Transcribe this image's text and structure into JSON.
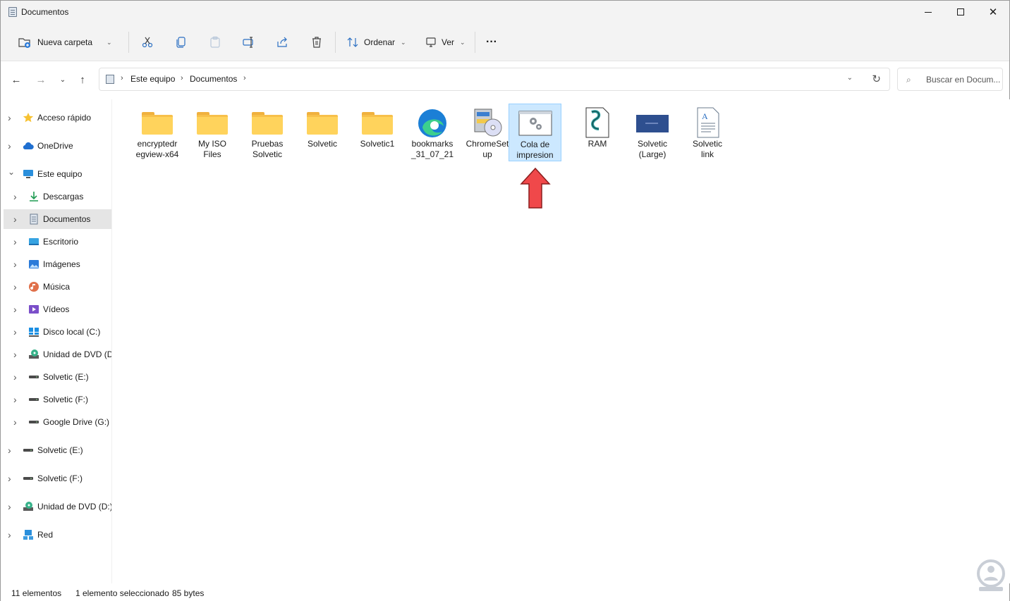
{
  "window": {
    "title": "Documentos"
  },
  "toolbar": {
    "new_folder": "Nueva carpeta",
    "sort": "Ordenar",
    "view": "Ver",
    "more": "···"
  },
  "address": {
    "crumbs": [
      "Este equipo",
      "Documentos"
    ]
  },
  "search": {
    "placeholder": "Buscar en Docum..."
  },
  "sidebar": {
    "items": [
      {
        "label": "Acceso rápido",
        "icon": "star-icon"
      },
      {
        "label": "OneDrive",
        "icon": "cloud-icon"
      },
      {
        "label": "Este equipo",
        "icon": "computer-icon"
      },
      {
        "label": "Descargas",
        "icon": "download-icon"
      },
      {
        "label": "Documentos",
        "icon": "documents-icon"
      },
      {
        "label": "Escritorio",
        "icon": "desktop-icon"
      },
      {
        "label": "Imágenes",
        "icon": "pictures-icon"
      },
      {
        "label": "Música",
        "icon": "music-icon"
      },
      {
        "label": "Vídeos",
        "icon": "videos-icon"
      },
      {
        "label": "Disco local (C:)",
        "icon": "local-disk-icon"
      },
      {
        "label": "Unidad de DVD (D:",
        "icon": "dvd-drive-icon"
      },
      {
        "label": "Solvetic (E:)",
        "icon": "drive-icon"
      },
      {
        "label": "Solvetic (F:)",
        "icon": "drive-icon"
      },
      {
        "label": "Google Drive (G:)",
        "icon": "drive-icon"
      },
      {
        "label": "Solvetic (E:)",
        "icon": "drive-icon"
      },
      {
        "label": "Solvetic (F:)",
        "icon": "drive-icon"
      },
      {
        "label": "Unidad de DVD (D:)",
        "icon": "dvd-drive-icon"
      },
      {
        "label": "Red",
        "icon": "network-icon"
      }
    ]
  },
  "files": [
    {
      "line1": "encryptedr",
      "line2": "egview-x64",
      "icon": "folder-icon"
    },
    {
      "line1": "My ISO",
      "line2": "Files",
      "icon": "folder-icon"
    },
    {
      "line1": "Pruebas",
      "line2": "Solvetic",
      "icon": "folder-icon"
    },
    {
      "line1": "Solvetic",
      "line2": "",
      "icon": "folder-icon"
    },
    {
      "line1": "Solvetic1",
      "line2": "",
      "icon": "folder-icon"
    },
    {
      "line1": "bookmarks",
      "line2": "_31_07_21",
      "icon": "edge-icon"
    },
    {
      "line1": "ChromeSet",
      "line2": "up",
      "icon": "installer-icon"
    },
    {
      "line1": "Cola de",
      "line2": "impresion",
      "icon": "settings-window-icon"
    },
    {
      "line1": "RAM",
      "line2": "",
      "icon": "script-icon"
    },
    {
      "line1": "Solvetic",
      "line2": "(Large)",
      "icon": "image-thumbnail-icon"
    },
    {
      "line1": "Solvetic",
      "line2": "link",
      "icon": "document-icon"
    }
  ],
  "status": {
    "count": "11 elementos",
    "selection": "1 elemento seleccionado",
    "size": "85 bytes"
  },
  "colors": {
    "selection": "#cce8ff",
    "folder": "#ffd35c",
    "arrow": "#f0484a"
  }
}
